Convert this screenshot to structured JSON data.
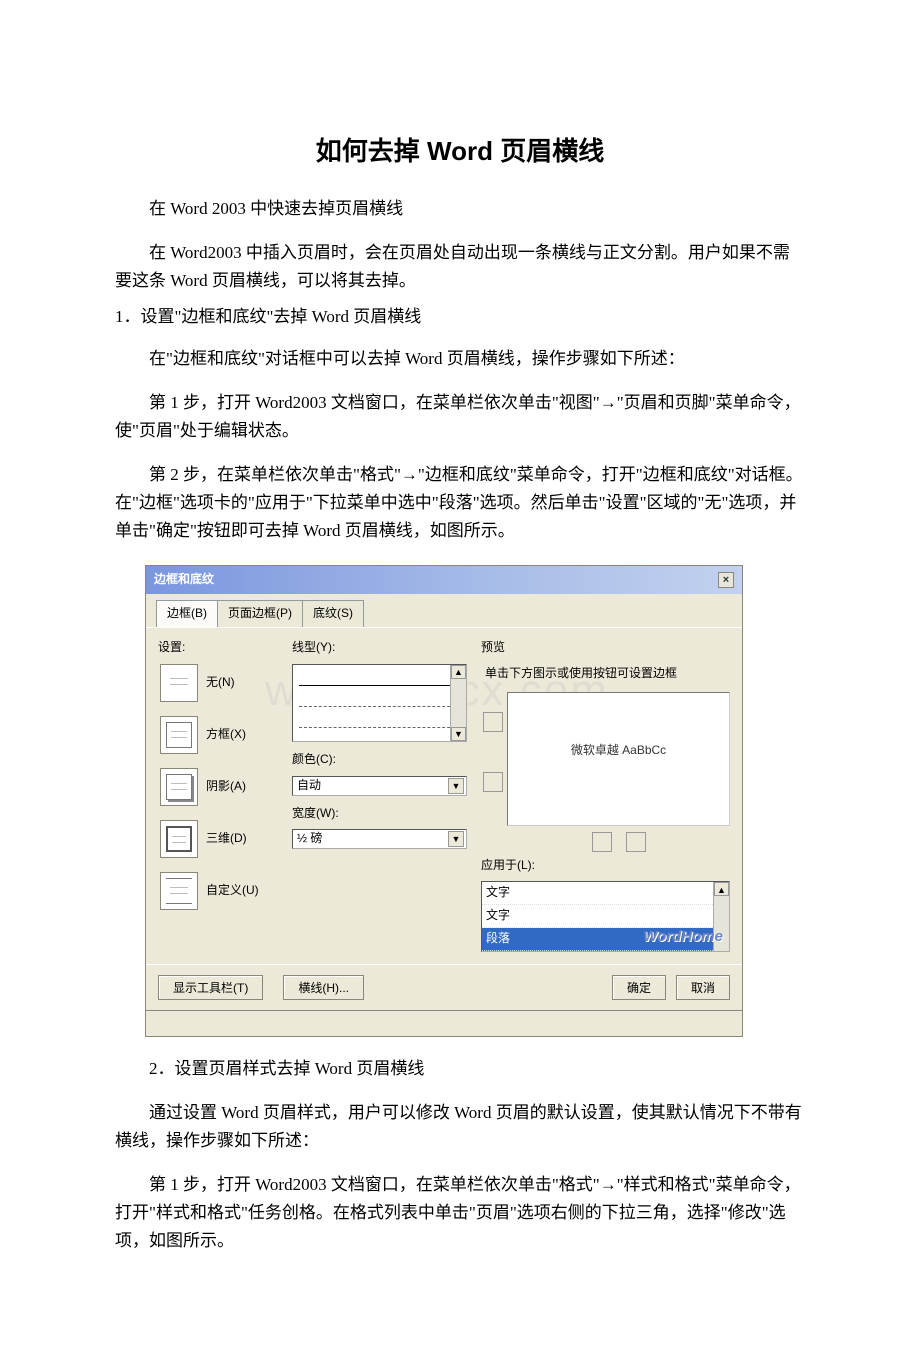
{
  "title": "如何去掉 Word 页眉横线",
  "intro": "在 Word 2003 中快速去掉页眉横线",
  "p1": "在 Word2003 中插入页眉时，会在页眉处自动出现一条横线与正文分割。用户如果不需要这条 Word 页眉横线，可以将其去掉。",
  "h1": "1．设置\"边框和底纹\"去掉 Word 页眉横线",
  "p2": "在\"边框和底纹\"对话框中可以去掉 Word 页眉横线，操作步骤如下所述：",
  "p3": "第 1 步，打开 Word2003 文档窗口，在菜单栏依次单击\"视图\"→\"页眉和页脚\"菜单命令，使\"页眉\"处于编辑状态。",
  "p4": "第 2 步，在菜单栏依次单击\"格式\"→\"边框和底纹\"菜单命令，打开\"边框和底纹\"对话框。在\"边框\"选项卡的\"应用于\"下拉菜单中选中\"段落\"选项。然后单击\"设置\"区域的\"无\"选项，并单击\"确定\"按钮即可去掉 Word 页眉横线，如图所示。",
  "h2a": "2．设置页眉样式去掉 Word 页眉横线",
  "p5": "通过设置 Word 页眉样式，用户可以修改 Word 页眉的默认设置，使其默认情况下不带有横线，操作步骤如下所述：",
  "p6": "第 1 步，打开 Word2003 文档窗口，在菜单栏依次单击\"格式\"→\"样式和格式\"菜单命令，打开\"样式和格式\"任务创格。在格式列表中单击\"页眉\"选项右侧的下拉三角，选择\"修改\"选项，如图所示。",
  "dialog": {
    "title": "边框和底纹",
    "tabs": {
      "t1": "边框(B)",
      "t2": "页面边框(P)",
      "t3": "底纹(S)"
    },
    "setting_label": "设置:",
    "settings": {
      "none": "无(N)",
      "box": "方框(X)",
      "shadow": "阴影(A)",
      "threeD": "三维(D)",
      "custom": "自定义(U)"
    },
    "linetype": "线型(Y):",
    "color": "颜色(C):",
    "color_val": "自动",
    "width": "宽度(W):",
    "width_val": "½ 磅",
    "preview": "预览",
    "preview_hint": "单击下方图示或使用按钮可设置边框",
    "preview_text": "微软卓越 AaBbCc",
    "apply": "应用于(L):",
    "apply_opts": {
      "a": "文字",
      "b": "文字",
      "c": "段落"
    },
    "toolbar_btn": "显示工具栏(T)",
    "hline_btn": "横线(H)...",
    "ok": "确定",
    "cancel": "取消",
    "watermark": "WordHome",
    "page_wm": "www.bdocx.com"
  }
}
